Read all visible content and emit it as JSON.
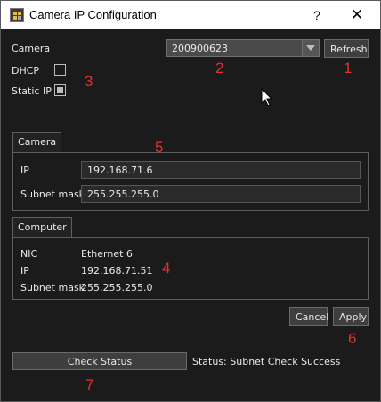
{
  "window": {
    "title": "Camera IP Configuration",
    "help_glyph": "?",
    "close_glyph": "✕"
  },
  "camera_row": {
    "label": "Camera",
    "selected_serial": "200900623",
    "refresh_label": "Refresh"
  },
  "mode": {
    "dhcp_label": "DHCP",
    "dhcp_checked": false,
    "static_label": "Static IP",
    "static_checked": true
  },
  "camera_group": {
    "title": "Camera",
    "ip_label": "IP",
    "ip_value": "192.168.71.6",
    "mask_label": "Subnet mask",
    "mask_value": "255.255.255.0"
  },
  "computer_group": {
    "title": "Computer",
    "nic_label": "NIC",
    "nic_value": "Ethernet 6",
    "ip_label": "IP",
    "ip_value": "192.168.71.51",
    "mask_label": "Subnet mask",
    "mask_value": "255.255.255.0"
  },
  "actions": {
    "cancel_label": "Cancel",
    "apply_label": "Apply",
    "check_status_label": "Check Status",
    "status_text": "Status: Subnet Check Success"
  },
  "annotations": {
    "n1": "1",
    "n2": "2",
    "n3": "3",
    "n4": "4",
    "n5": "5",
    "n6": "6",
    "n7": "7"
  },
  "colors": {
    "annotation": "#e03030",
    "background": "#1b1b1b"
  }
}
